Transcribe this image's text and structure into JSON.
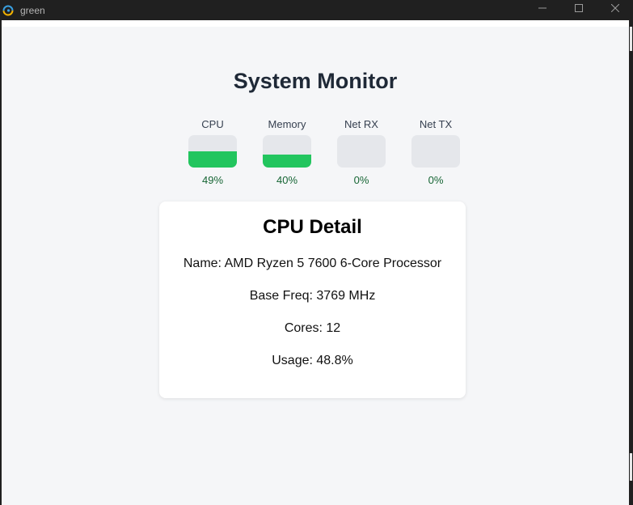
{
  "window": {
    "title": "green",
    "controls": {
      "minimize_icon": "minimize-icon",
      "maximize_icon": "maximize-icon",
      "close_icon": "close-icon"
    }
  },
  "page": {
    "title": "System Monitor"
  },
  "meters": [
    {
      "label": "CPU",
      "value_text": "49%",
      "fill_percent": 49
    },
    {
      "label": "Memory",
      "value_text": "40%",
      "fill_percent": 40
    },
    {
      "label": "Net RX",
      "value_text": "0%",
      "fill_percent": 0
    },
    {
      "label": "Net TX",
      "value_text": "0%",
      "fill_percent": 0
    }
  ],
  "detail": {
    "title": "CPU Detail",
    "name": "Name: AMD Ryzen 5 7600 6-Core Processor",
    "base_freq": "Base Freq: 3769 MHz",
    "cores": "Cores: 12",
    "usage": "Usage: 48.8%"
  },
  "colors": {
    "accent_fill": "#22c55e",
    "meter_track": "#e5e7eb",
    "value_text": "#166534",
    "background": "#f5f6f8",
    "titlebar": "#202020"
  }
}
